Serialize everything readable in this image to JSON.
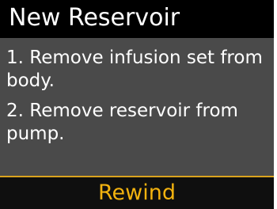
{
  "screen": {
    "title": "New Reservoir",
    "steps": [
      "1. Remove infusion set from body.",
      "2. Remove reservoir from pump."
    ],
    "action_label": "Rewind"
  },
  "colors": {
    "title_bg": "#000000",
    "body_bg": "#4a4a4a",
    "text": "#ffffff",
    "accent": "#f2b20f",
    "divider": "#d9a21e",
    "action_bg": "#0f0f0f"
  }
}
